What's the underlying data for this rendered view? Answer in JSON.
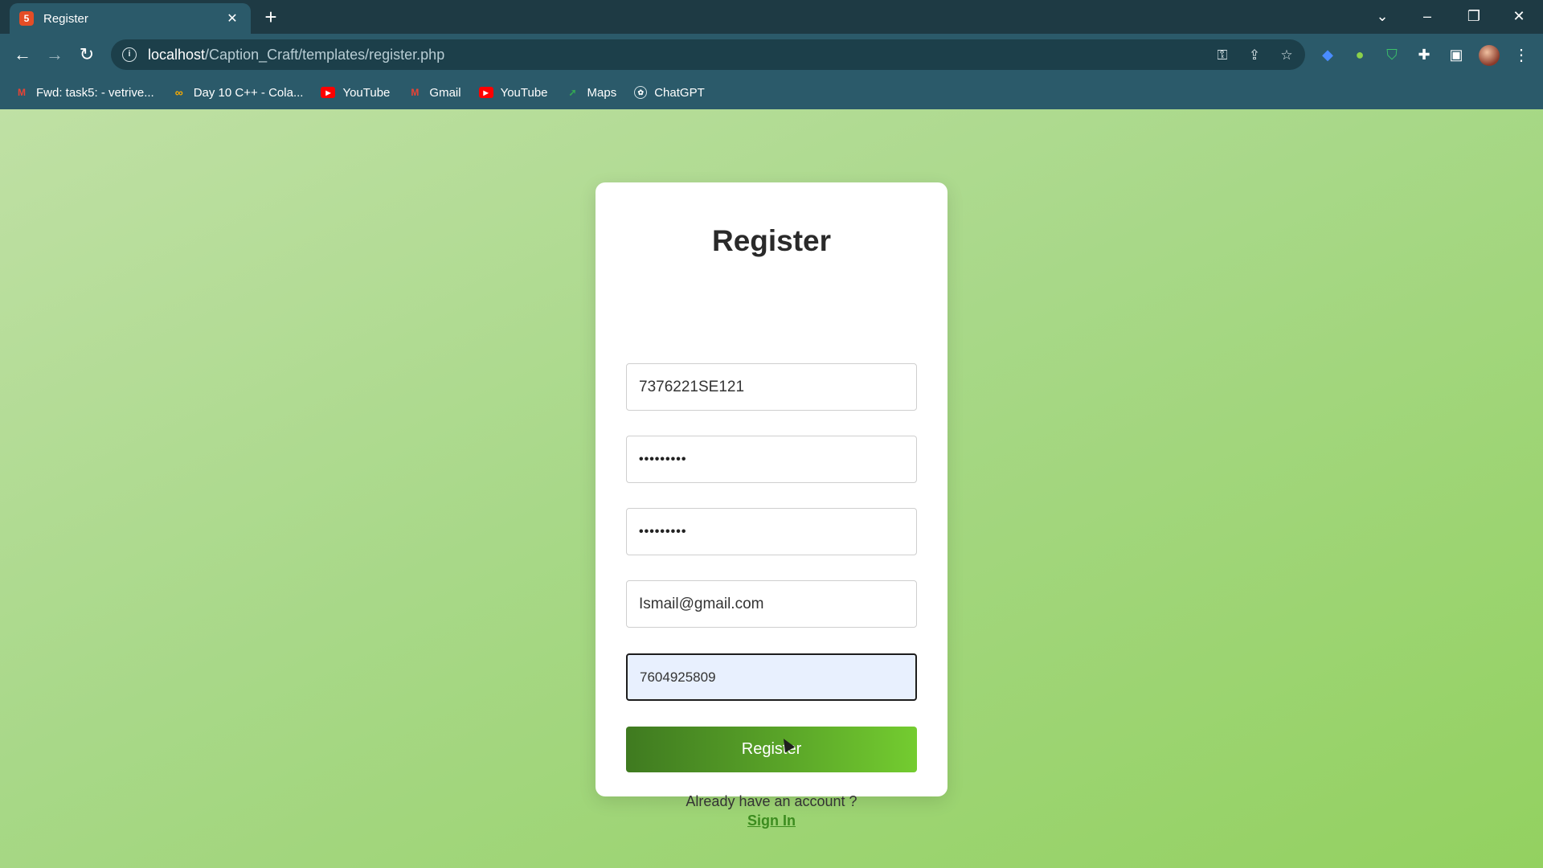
{
  "browser": {
    "tab_title": "Register",
    "tab_favicon_letter": "5",
    "url_host": "localhost",
    "url_path": "/Caption_Craft/templates/register.php",
    "bookmarks": [
      {
        "label": "Fwd: task5: - vetrive...",
        "icon": "gmail-icon"
      },
      {
        "label": "Day 10 C++ - Cola...",
        "icon": "colab-icon"
      },
      {
        "label": "YouTube",
        "icon": "youtube-icon"
      },
      {
        "label": "Gmail",
        "icon": "gmail-icon"
      },
      {
        "label": "YouTube",
        "icon": "youtube-icon"
      },
      {
        "label": "Maps",
        "icon": "maps-icon"
      },
      {
        "label": "ChatGPT",
        "icon": "chatgpt-icon"
      }
    ]
  },
  "form": {
    "title": "Register",
    "username_value": "7376221SE121",
    "password_value": "•••••••••",
    "confirm_password_value": "•••••••••",
    "email_value": "Ismail@gmail.com",
    "phone_value": "7604925809",
    "register_label": "Register",
    "signin_prompt": "Already have an account ?",
    "signin_link": "Sign In"
  },
  "colors": {
    "chrome_bg": "#2b5a6a",
    "page_gradient_start": "#bfe0a4",
    "page_gradient_end": "#93d160",
    "button_gradient_start": "#3f7a20",
    "button_gradient_end": "#74cc30",
    "link_color": "#3c8c1f"
  }
}
